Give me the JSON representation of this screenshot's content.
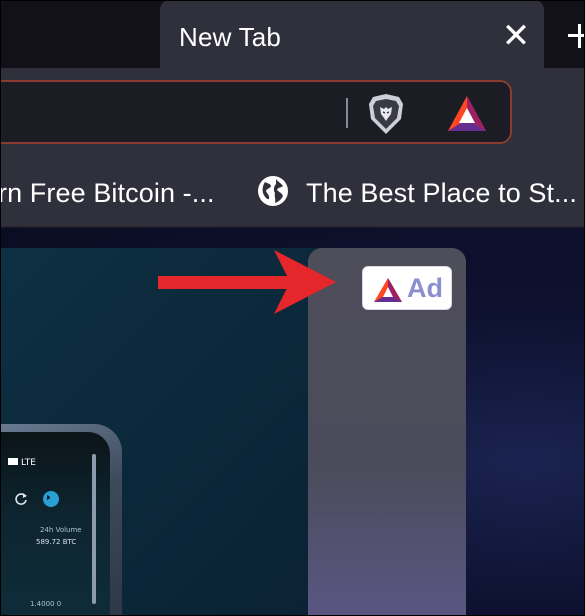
{
  "tab": {
    "title": "New Tab",
    "close_glyph": "✕"
  },
  "toolbar": {
    "shield_icon": "brave-lion-shield-icon",
    "rewards_icon": "bat-triangle-icon"
  },
  "bookmarks": [
    {
      "label": "rn Free Bitcoin -...",
      "icon": ""
    },
    {
      "label": "The Best Place to St...",
      "icon": "globe-icon"
    }
  ],
  "ad_badge": {
    "label": "Ad",
    "icon": "bat-triangle-icon"
  },
  "phone": {
    "status_text": "LTE",
    "volume_label": "24h Volume",
    "volume_value": "589.72 BTC",
    "bottom_value": "1.4000 0"
  },
  "colors": {
    "accent_red": "#e5262b",
    "urlbar_border": "#8b3a2e",
    "ad_text": "#8b8fd0"
  }
}
